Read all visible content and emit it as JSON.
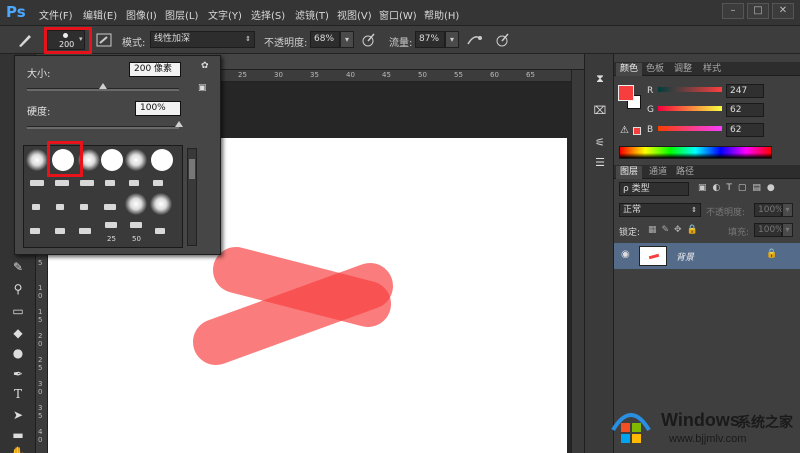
{
  "app": {
    "logo": "Ps",
    "window_buttons": [
      "–",
      "□",
      "✕"
    ]
  },
  "menu": [
    "文件(F)",
    "编辑(E)",
    "图像(I)",
    "图层(L)",
    "文字(Y)",
    "选择(S)",
    "滤镜(T)",
    "视图(V)",
    "窗口(W)",
    "帮助(H)"
  ],
  "options": {
    "brush_size": "200",
    "mode_label": "模式:",
    "mode_value": "线性加深",
    "opacity_label": "不透明度:",
    "opacity_value": "68%",
    "flow_label": "流量:",
    "flow_value": "87%"
  },
  "brush_panel": {
    "size_label": "大小:",
    "size_value": "200 像素",
    "size_level": 0.5,
    "hardness_label": "硬度:",
    "hardness_value": "100%",
    "hardness_level": 1.0,
    "preset_numbers": [
      "25",
      "50"
    ]
  },
  "rulers": {
    "top": [
      "25",
      "30",
      "35",
      "40",
      "45",
      "50",
      "55",
      "60",
      "65"
    ],
    "left": [
      "5",
      "1 0",
      "1 5",
      "2 0",
      "2 5",
      "3 0",
      "3 5",
      "4 0"
    ]
  },
  "color_panel": {
    "tabs": [
      "颜色",
      "色板",
      "调整",
      "样式"
    ],
    "channels": [
      {
        "label": "R",
        "value": "247"
      },
      {
        "label": "G",
        "value": "62"
      },
      {
        "label": "B",
        "value": "62"
      }
    ],
    "foreground": "#f73e3e",
    "background": "#ffffff"
  },
  "layers_panel": {
    "tabs": [
      "图层",
      "通道",
      "路径"
    ],
    "filter_label": "ρ 类型",
    "blend_mode": "正常",
    "opacity_label": "不透明度:",
    "opacity_value": "100%",
    "lock_label": "锁定:",
    "fill_label": "填充:",
    "fill_value": "100%",
    "layer_name": "背景"
  },
  "watermark": {
    "brand": "Windows",
    "cn": "系统之家",
    "url": "www.bjjmlv.com"
  }
}
